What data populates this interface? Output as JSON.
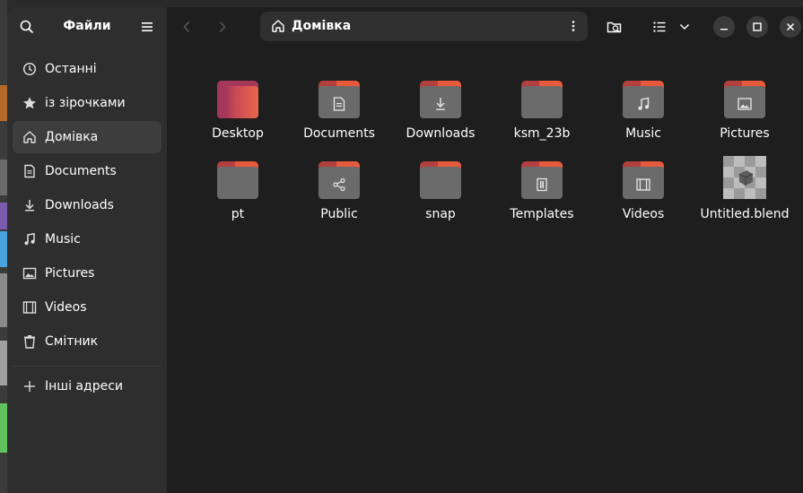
{
  "app": {
    "title": "Файли",
    "colors": {
      "window_bg": "#1e1e1e",
      "sidebar_bg": "#2e2e2e",
      "folder_accent": "#e65a3c",
      "folder_body": "#6b6b6b"
    }
  },
  "sidebar": {
    "items": [
      {
        "label": "Останні",
        "icon": "clock-icon"
      },
      {
        "label": "із зірочками",
        "icon": "star-icon"
      },
      {
        "label": "Домівка",
        "icon": "home-icon",
        "active": true
      },
      {
        "label": "Documents",
        "icon": "document-icon"
      },
      {
        "label": "Downloads",
        "icon": "download-icon"
      },
      {
        "label": "Music",
        "icon": "music-icon"
      },
      {
        "label": "Pictures",
        "icon": "picture-icon"
      },
      {
        "label": "Videos",
        "icon": "video-icon"
      },
      {
        "label": "Смітник",
        "icon": "trash-icon"
      }
    ],
    "other_locations": {
      "label": "Інші адреси",
      "icon": "plus-icon"
    }
  },
  "toolbar": {
    "path_label": "Домівка",
    "path_icon": "home-icon"
  },
  "files": [
    {
      "name": "Desktop",
      "kind": "desktop-folder"
    },
    {
      "name": "Documents",
      "kind": "folder",
      "emblem": "document-icon"
    },
    {
      "name": "Downloads",
      "kind": "folder",
      "emblem": "download-icon"
    },
    {
      "name": "ksm_23b",
      "kind": "folder"
    },
    {
      "name": "Music",
      "kind": "folder",
      "emblem": "music-icon"
    },
    {
      "name": "Pictures",
      "kind": "folder",
      "emblem": "picture-icon"
    },
    {
      "name": "pt",
      "kind": "folder"
    },
    {
      "name": "Public",
      "kind": "folder",
      "emblem": "share-icon"
    },
    {
      "name": "snap",
      "kind": "folder"
    },
    {
      "name": "Templates",
      "kind": "folder",
      "emblem": "template-icon"
    },
    {
      "name": "Videos",
      "kind": "folder",
      "emblem": "video-icon"
    },
    {
      "name": "Untitled.blend",
      "kind": "blend-file"
    }
  ]
}
